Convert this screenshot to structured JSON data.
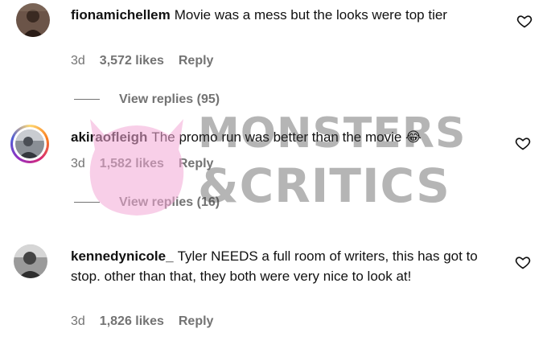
{
  "comments": [
    {
      "username": "fionamichellem",
      "text": "Movie was a mess but the looks were top tier",
      "time": "3d",
      "likes": "3,572 likes",
      "reply_label": "Reply",
      "view_replies": "View replies (95)"
    },
    {
      "username": "akiraofleigh",
      "text": "The promo run was better than the movie",
      "emoji": "😂",
      "time": "3d",
      "likes": "1,582 likes",
      "reply_label": "Reply",
      "view_replies": "View replies (16)"
    },
    {
      "username": "kennedynicole_",
      "text": "Tyler NEEDS a full room of writers, this has got to stop. other than that, they both were very nice to look at!",
      "time": "3d",
      "likes": "1,826 likes",
      "reply_label": "Reply"
    }
  ],
  "watermark": {
    "line1": "MONSTERS",
    "line2": "&CRITICS"
  },
  "icons": {
    "like": "heart-outline-icon"
  },
  "colors": {
    "secondary_text": "#737373",
    "watermark_pink": "#f7c6e3"
  }
}
